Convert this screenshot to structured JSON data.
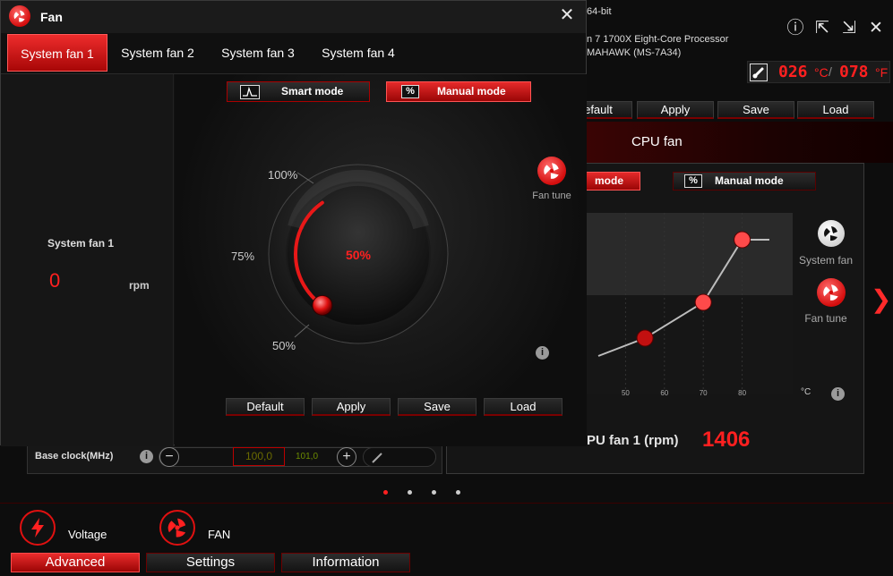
{
  "app": {
    "os_text": "64-bit",
    "cpu_text": "n 7 1700X Eight-Core Processor",
    "board_text": "MAHAWK (MS-7A34)",
    "cpu_temp": "026",
    "system_temp": "078",
    "temp_unit_c": "°C",
    "temp_unit_f": "°F",
    "window_buttons": {
      "info": "ⓘ",
      "minimize": "⇱",
      "restore": "⇲",
      "close": "✕"
    }
  },
  "main_fan_panel": {
    "buttons": [
      "efault",
      "Apply",
      "Save",
      "Load"
    ],
    "title": "CPU fan",
    "smart_mode_label": "mode",
    "manual_mode_label": "Manual mode",
    "manual_icon": "%",
    "side_icons": [
      {
        "label": "System fan",
        "icon": "fan-white-icon"
      },
      {
        "label": "Fan tune",
        "icon": "fan-red-icon"
      }
    ],
    "x_ticks": [
      "50",
      "60",
      "70",
      "80"
    ],
    "x_unit": "°C",
    "readout_label": "PU fan 1 (rpm)",
    "readout_value": "1406",
    "next_arrow": "❯"
  },
  "base_clock": {
    "label": "Base clock(MHz)",
    "value": "100,0",
    "actual": "101,0",
    "minus": "−",
    "plus": "+"
  },
  "page_dots": 4,
  "bottom_nav": {
    "icons": [
      {
        "label": "Voltage",
        "icon": "lightning-icon"
      },
      {
        "label": "FAN",
        "icon": "fan-icon"
      }
    ],
    "buttons": [
      "Advanced",
      "Settings",
      "Information"
    ],
    "active": "Advanced"
  },
  "fan_dialog": {
    "title": "Fan",
    "close": "✕",
    "tabs": [
      "System fan 1",
      "System fan 2",
      "System fan 3",
      "System fan 4"
    ],
    "active_tab": "System fan 1",
    "smart_mode_label": "Smart mode",
    "manual_mode_label": "Manual mode",
    "manual_icon": "%",
    "left_panel": {
      "name": "System fan 1",
      "rpm_value": "0",
      "rpm_unit": "rpm"
    },
    "dial": {
      "label_100": "100%",
      "label_75": "75%",
      "label_50": "50%",
      "value_text": "50%",
      "value": 50
    },
    "fan_tune_label": "Fan tune",
    "info": "i",
    "buttons": [
      "Default",
      "Apply",
      "Save",
      "Load"
    ]
  },
  "chart_data": {
    "type": "line",
    "x": [
      43,
      55,
      70,
      80,
      87
    ],
    "y": [
      20,
      30,
      50,
      85,
      85
    ],
    "x_ticks": [
      50,
      60,
      70,
      80
    ],
    "xlim": [
      40,
      93
    ],
    "ylim": [
      0,
      100
    ],
    "xlabel": "°C",
    "ylabel": ""
  },
  "colors": {
    "accent": "#e01010",
    "accent_light": "#ff4a4a",
    "bg": "#0d0d0d"
  }
}
